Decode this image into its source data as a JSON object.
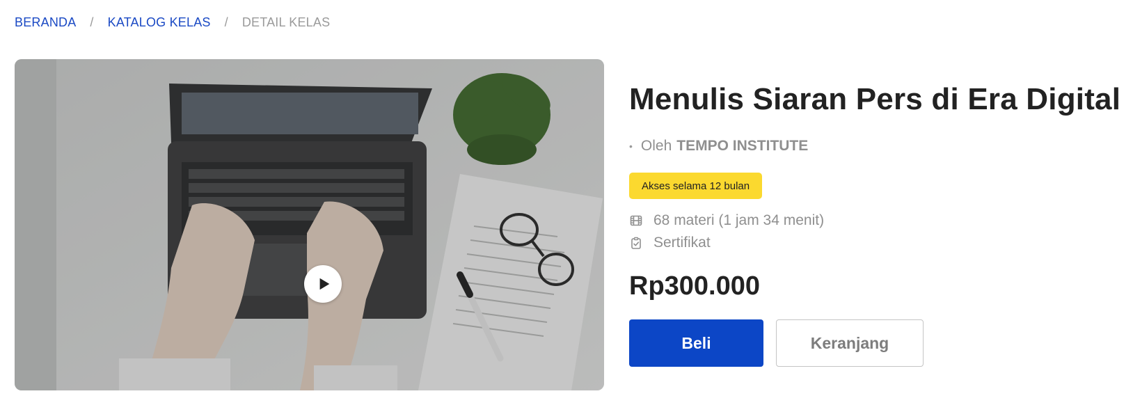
{
  "breadcrumb": {
    "home": "BERANDA",
    "separator": "/",
    "catalog": "KATALOG KELAS",
    "current": "DETAIL KELAS"
  },
  "media": {
    "play_icon": "play-icon"
  },
  "course": {
    "title": "Menulis Siaran Pers di Era Digital",
    "author_bullet": "•",
    "author_prefix": "Oleh",
    "author_name": "TEMPO INSTITUTE",
    "access_badge": "Akses selama 12 bulan",
    "materials": "68 materi (1 jam 34 menit)",
    "materials_icon": "film-icon",
    "certificate": "Sertifikat",
    "certificate_icon": "clipboard-check-icon",
    "price": "Rp300.000"
  },
  "actions": {
    "buy_label": "Beli",
    "cart_label": "Keranjang"
  },
  "colors": {
    "primary": "#0c46c6",
    "link": "#1a49c4",
    "badge": "#fbd92f",
    "muted": "#8f8f8f"
  }
}
